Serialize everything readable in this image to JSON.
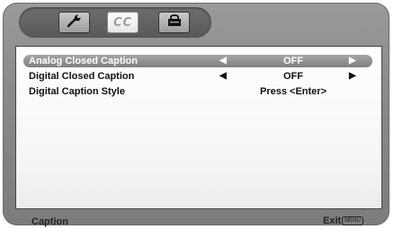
{
  "tabs": [
    {
      "icon": "wrench-icon",
      "label": ""
    },
    {
      "icon": "cc-icon",
      "label": "CC"
    },
    {
      "icon": "lock-icon",
      "label": ""
    }
  ],
  "menu": {
    "items": [
      {
        "label": "Analog Closed Caption",
        "value": "OFF",
        "has_arrows": true,
        "selected": true
      },
      {
        "label": "Digital Closed Caption",
        "value": "OFF",
        "has_arrows": true,
        "selected": false
      },
      {
        "label": "Digital Caption Style",
        "value": "Press <Enter>",
        "has_arrows": false,
        "selected": false
      }
    ],
    "arrow_left": "◀",
    "arrow_right": "▶"
  },
  "footer": {
    "title": "Caption",
    "exit_label": "Exit",
    "exit_key": "MENU"
  }
}
